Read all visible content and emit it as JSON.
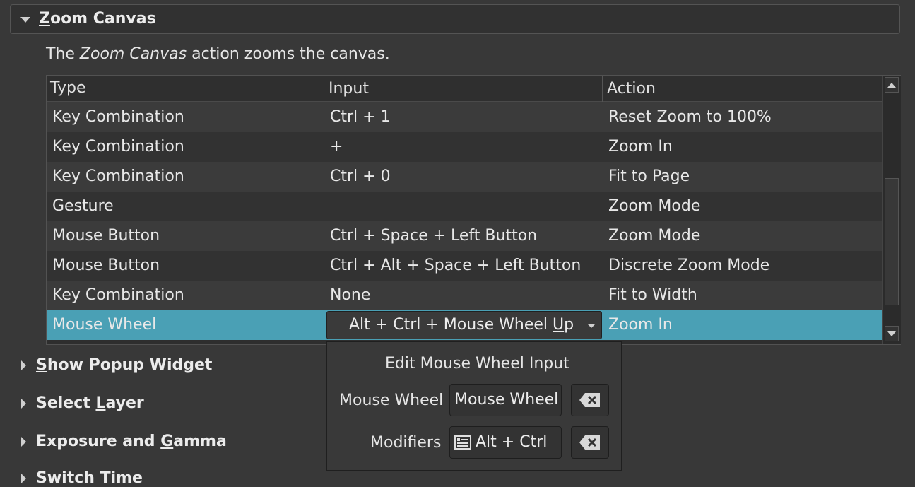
{
  "section": {
    "title_pre": "",
    "title_underlined": "Z",
    "title_post": "oom Canvas",
    "desc_pre": "The ",
    "desc_em": "Zoom Canvas",
    "desc_post": " action zooms the canvas."
  },
  "table": {
    "headers": [
      "Type",
      "Input",
      "Action"
    ],
    "rows": [
      {
        "type": "Key Combination",
        "input": "Ctrl + 1",
        "action": "Reset Zoom to 100%"
      },
      {
        "type": "Key Combination",
        "input": "+",
        "action": "Zoom In"
      },
      {
        "type": "Key Combination",
        "input": "Ctrl + 0",
        "action": "Fit to Page"
      },
      {
        "type": "Gesture",
        "input": "",
        "action": "Zoom Mode"
      },
      {
        "type": "Mouse Button",
        "input": "Ctrl + Space + Left Button",
        "action": "Zoom Mode"
      },
      {
        "type": "Mouse Button",
        "input": "Ctrl + Alt + Space + Left Button",
        "action": "Discrete Zoom Mode"
      },
      {
        "type": "Key Combination",
        "input": "None",
        "action": "Fit to Width"
      },
      {
        "type": "Mouse Wheel",
        "input": "",
        "action": "Zoom In"
      }
    ],
    "selected_input_pre": "Alt + Ctrl + Mouse Wheel ",
    "selected_input_u": "U",
    "selected_input_post": "p"
  },
  "popup": {
    "title": "Edit Mouse Wheel Input",
    "wheel_label": "Mouse Wheel",
    "wheel_value": "Mouse Wheel Up",
    "modifiers_label": "Modifiers",
    "modifiers_value": "Alt + Ctrl"
  },
  "collapsed_sections": [
    {
      "u": "S",
      "rest": "how Popup Widget",
      "pre": ""
    },
    {
      "pre": "Select ",
      "u": "L",
      "rest": "ayer"
    },
    {
      "pre": "Exposure and ",
      "u": "G",
      "rest": "amma"
    },
    {
      "pre": "Switch Time",
      "u": "",
      "rest": ""
    }
  ],
  "colors": {
    "selection": "#4aa0b5",
    "background": "#383838"
  }
}
